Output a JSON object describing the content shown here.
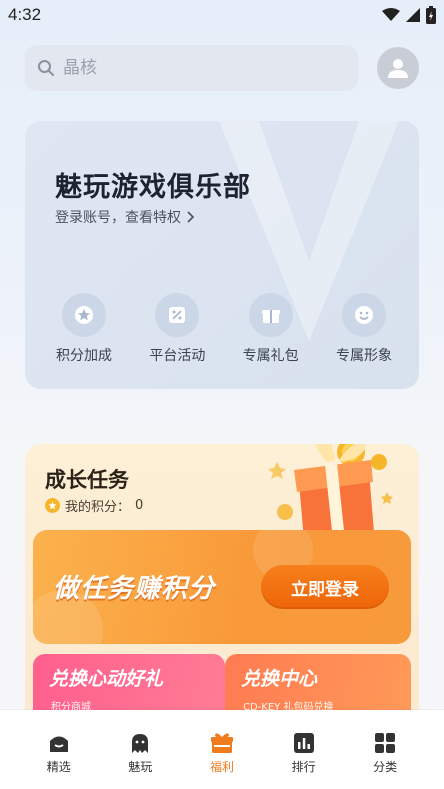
{
  "status_bar": {
    "time": "4:32"
  },
  "search": {
    "placeholder": "晶核"
  },
  "club": {
    "title": "魅玩游戏俱乐部",
    "subtitle": "登录账号，查看特权",
    "perks": [
      {
        "label": "积分加成",
        "icon": "star-badge-icon"
      },
      {
        "label": "平台活动",
        "icon": "percent-tag-icon"
      },
      {
        "label": "专属礼包",
        "icon": "gift-icon"
      },
      {
        "label": "专属形象",
        "icon": "smile-face-icon"
      }
    ]
  },
  "tasks": {
    "title": "成长任务",
    "points_label": "我的积分：",
    "points_value": "0",
    "banner_text": "做任务赚积分",
    "login_button": "立即登录",
    "redeem_gifts": {
      "title": "兑换心动好礼",
      "subtitle": "积分商城"
    },
    "redeem_center": {
      "title": "兑换中心",
      "subtitle": "CD-KEY 礼包码兑换"
    }
  },
  "tabbar": {
    "items": [
      {
        "label": "精选",
        "icon": "home-icon"
      },
      {
        "label": "魅玩",
        "icon": "ghost-icon"
      },
      {
        "label": "福利",
        "icon": "gift-box-icon",
        "active": true
      },
      {
        "label": "排行",
        "icon": "bar-chart-icon"
      },
      {
        "label": "分类",
        "icon": "grid-icon"
      }
    ]
  },
  "colors": {
    "accent": "#f07c1e",
    "banner_orange": "#f99a3a",
    "pink": "#ff5f8d"
  }
}
